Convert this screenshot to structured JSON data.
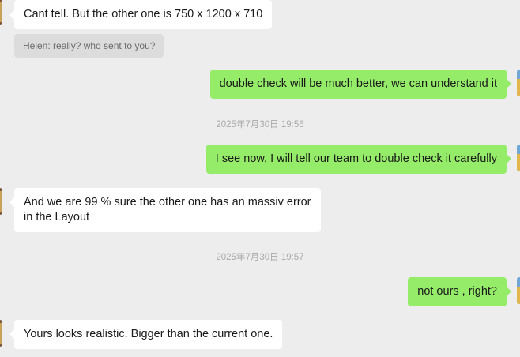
{
  "chat": {
    "messages": [
      {
        "side": "in",
        "text": "Cant tell. But the other one is 750 x 1200 x 710"
      },
      {
        "side": "quote",
        "text": "Helen: really? who sent to you?"
      },
      {
        "side": "out",
        "text": "double check will be much better, we can understand it"
      },
      {
        "side": "time",
        "text": "2025年7月30日 19:56"
      },
      {
        "side": "out",
        "text": "I see now, I will tell our team to double check it carefully"
      },
      {
        "side": "in",
        "text": "And we are 99 % sure the other one has an massiv error in the Layout"
      },
      {
        "side": "time",
        "text": "2025年7月30日 19:57"
      },
      {
        "side": "out",
        "text": "not ours , right?"
      },
      {
        "side": "in",
        "text": "Yours looks realistic. Bigger than the current one."
      }
    ]
  },
  "colors": {
    "background": "#ededed",
    "incoming_bubble": "#ffffff",
    "outgoing_bubble": "#95ec69",
    "quote_bubble": "#dcdcdc",
    "timestamp_text": "#a8a8a8"
  },
  "icons": {
    "contact_avatar": "contact-avatar-icon",
    "self_avatar": "self-avatar-icon"
  }
}
